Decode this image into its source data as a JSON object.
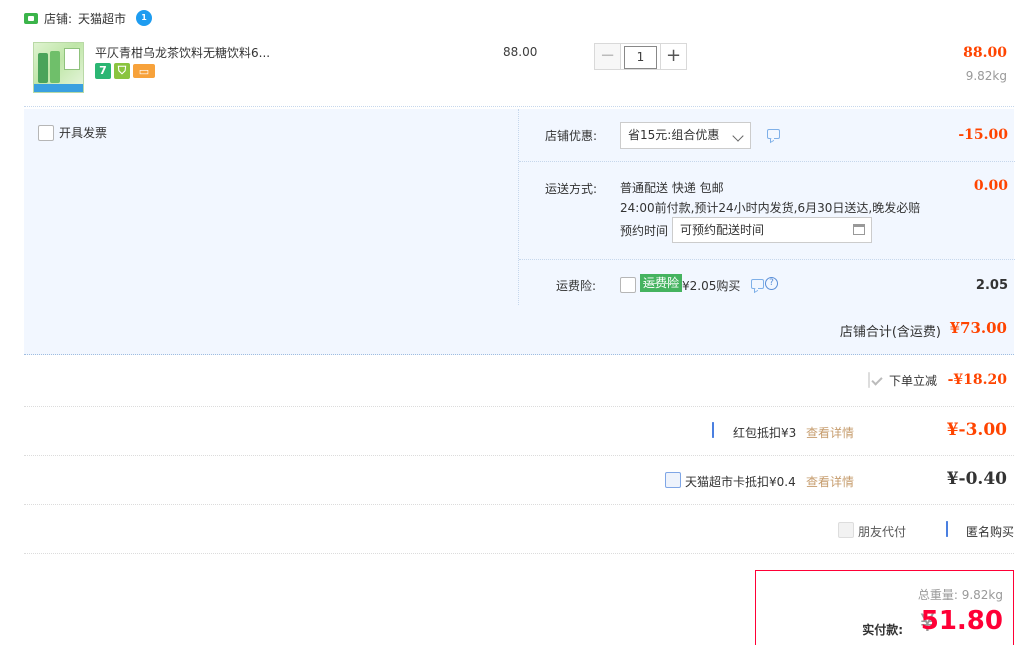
{
  "shop": {
    "label": "店铺:",
    "name": "天猫超市",
    "ww_badge": "1"
  },
  "item": {
    "title": "平仄青柑乌龙茶饮料无糖饮料6...",
    "badges": [
      {
        "icon": "seven-day-return-icon",
        "text": "7"
      },
      {
        "icon": "shield-icon",
        "text": ""
      },
      {
        "icon": "credit-card-icon",
        "text": ""
      }
    ],
    "unit_price": "88.00",
    "quantity": "1",
    "minus": "−",
    "plus": "+",
    "total": "88.00",
    "weight": "9.82kg"
  },
  "invoice": {
    "label": "开具发票"
  },
  "discount": {
    "label": "店铺优惠:",
    "selected": "省15元:组合优惠",
    "value": "-15.00"
  },
  "shipping": {
    "label": "运送方式:",
    "line1": "普通配送 快递 包邮",
    "line2": "24:00前付款,预计24小时内发货,6月30日送达,晚发必赔",
    "reserve_label": "预约时间",
    "reserve_value": "可预约配送时间",
    "value": "0.00"
  },
  "insurance": {
    "label": "运费险:",
    "tag": "运费险",
    "price": "¥2.05购买",
    "help": "?",
    "value": "2.05"
  },
  "shop_total": {
    "label": "店铺合计(含运费)",
    "value": "¥73.00"
  },
  "instant_off": {
    "label": "下单立减",
    "value": "-¥18.20"
  },
  "red_packet": {
    "label": "红包抵扣¥3",
    "link": "查看详情",
    "value": "¥-3.00"
  },
  "tmall_card": {
    "label": "天猫超市卡抵扣¥0.4",
    "link": "查看详情",
    "value": "¥-0.40"
  },
  "options": {
    "friend_pay": "朋友代付",
    "anonymous": "匿名购买"
  },
  "summary": {
    "weight": "总重量: 9.82kg",
    "pay_label": "实付款:",
    "yen": "¥",
    "amount": "51.80"
  },
  "colors": {
    "price_red": "#ff4400",
    "pay_red": "#ff0036",
    "panel_bg": "#f2f7ff",
    "link_gold": "#c69c6d"
  }
}
